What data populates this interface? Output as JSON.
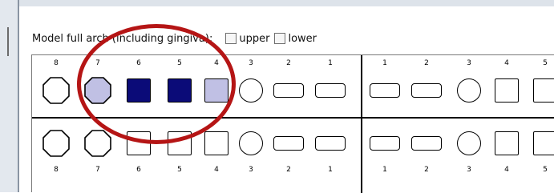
{
  "header": {
    "label": "Model full arch (including gingiva):",
    "upper_label": "upper",
    "lower_label": "lower"
  },
  "upper_numbers": [
    "8",
    "7",
    "6",
    "5",
    "4",
    "3",
    "2",
    "1",
    "1",
    "2",
    "3",
    "4",
    "5"
  ],
  "lower_numbers": [
    "8",
    "7",
    "6",
    "5",
    "4",
    "3",
    "2",
    "1",
    "1",
    "2",
    "3",
    "4",
    "5"
  ],
  "colors": {
    "selected_dark": "#0b0b78",
    "selected_light": "#c0c0e4",
    "annotation_ring": "#b51515"
  },
  "upper_states": [
    "none",
    "light",
    "dark",
    "dark",
    "light",
    "none",
    "none",
    "none",
    "none",
    "none",
    "none",
    "none",
    "none"
  ]
}
